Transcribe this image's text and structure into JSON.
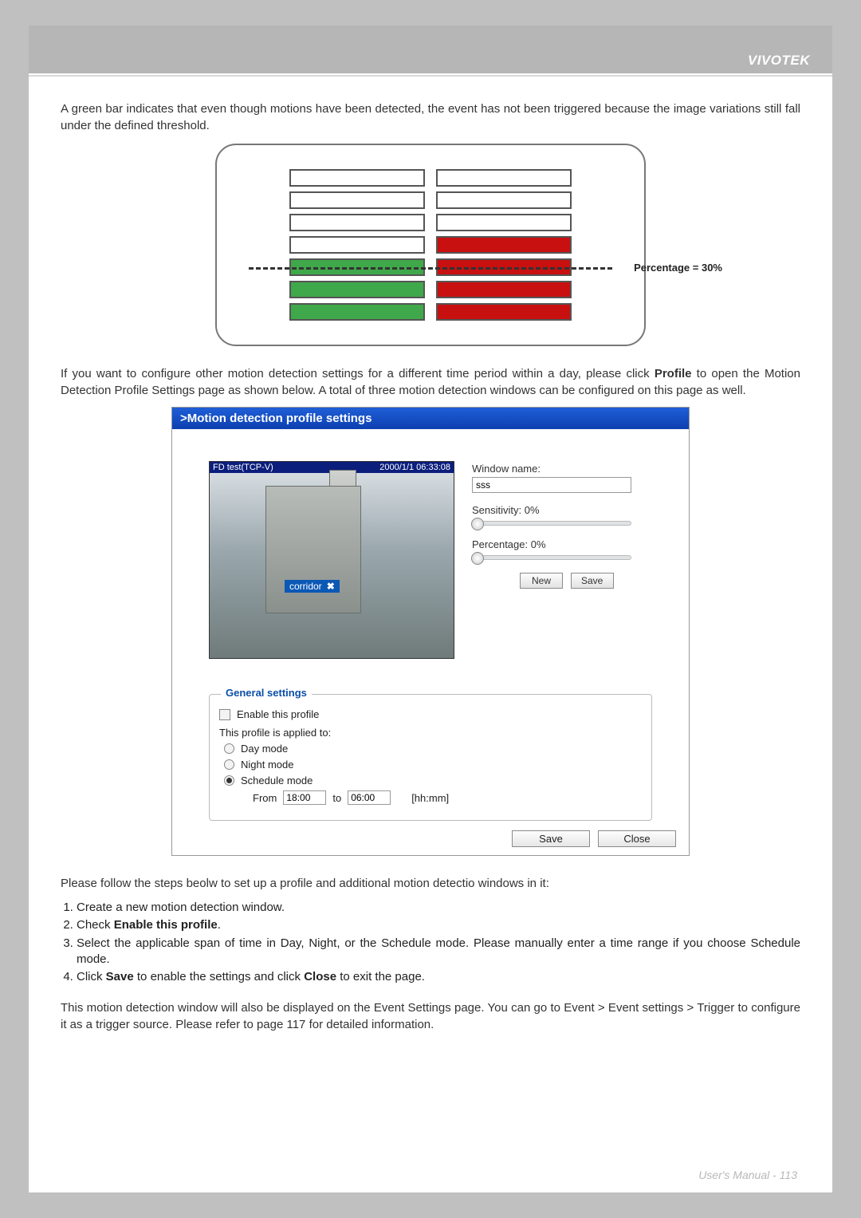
{
  "header": {
    "brand": "VIVOTEK"
  },
  "intro": "A green bar indicates that even though motions have been detected, the event has not been triggered because the image variations still fall under the defined threshold.",
  "diagram1": {
    "percentage_label": "Percentage = 30%"
  },
  "para2_a": "If you want to configure other motion detection settings for a different time period within a day, please click ",
  "para2_b": "Profile",
  "para2_c": " to open the Motion Detection Profile Settings page as shown below. A total of three motion detection windows can be configured on this page as well.",
  "profile": {
    "title": ">Motion detection profile settings",
    "preview": {
      "name": "FD test(TCP-V)",
      "timestamp": "2000/1/1 06:33:08",
      "tag": "corridor"
    },
    "controls": {
      "window_name_label": "Window name:",
      "window_name_value": "sss",
      "sensitivity_label": "Sensitivity: 0%",
      "percentage_label": "Percentage: 0%",
      "new_btn": "New",
      "save_btn": "Save"
    },
    "general": {
      "legend": "General settings",
      "enable": "Enable this profile",
      "applied": "This profile is applied to:",
      "day": "Day mode",
      "night": "Night mode",
      "schedule": "Schedule mode",
      "from_lbl": "From",
      "from_val": "18:00",
      "to_lbl": "to",
      "to_val": "06:00",
      "hhmm": "[hh:mm]"
    },
    "bottom": {
      "save": "Save",
      "close": "Close"
    }
  },
  "steps_intro": "Please follow the steps beolw to set up a profile and additional motion detectio windows in it:",
  "steps": {
    "s1": "Create a new motion detection window.",
    "s2a": "Check ",
    "s2b": "Enable this profile",
    "s2c": ".",
    "s3": "Select the applicable span of time in Day, Night, or the Schedule mode. Please manually enter a time range if you choose Schedule mode.",
    "s4a": "Click ",
    "s4b": "Save",
    "s4c": " to enable the settings and click ",
    "s4d": "Close",
    "s4e": " to exit the page."
  },
  "outro": "This motion detection window will also be displayed on the Event Settings page. You can go to Event > Event settings > Trigger to configure it as a trigger source. Please refer to page 117 for detailed information.",
  "footer": {
    "label": "User's Manual - ",
    "pg": "113"
  }
}
